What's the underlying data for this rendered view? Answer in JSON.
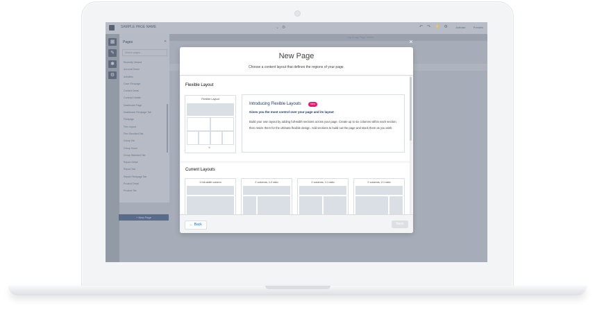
{
  "app": {
    "title": "SAMPLE PAGE NAME",
    "canvas_label": "Lightning Page Name",
    "header_right": [
      "Activate",
      "Preview"
    ],
    "icons": [
      "menu-icon",
      "undo-icon",
      "redo-icon",
      "settings-icon"
    ]
  },
  "sidebar": {
    "title": "Pages",
    "close": "✕",
    "search_placeholder": "Search pages...",
    "items": [
      "Recently Viewed",
      "Account Detail",
      "Activities",
      "Case Flexipage",
      "Contact Detail",
      "Contract Details",
      "Dashboard Page",
      "Dashboard Flexipage Tab",
      "Flexipage",
      "Flex Layout",
      "Flex Standard Tab",
      "Group Tab",
      "Group Home",
      "Group Standard Tab",
      "Report Detail",
      "Report Tab",
      "Report Flexipage Tab",
      "Product Detail",
      "Product Tab"
    ],
    "new_page_button": "+ New Page"
  },
  "modal": {
    "title": "New Page",
    "subtitle": "Choose a content layout that defines the regions of your page.",
    "flexible": {
      "heading": "Flexible Layout",
      "thumb_label": "Flexible Layout",
      "intro_title": "Introducing Flexible Layouts",
      "badge": "New",
      "intro_subtitle": "Gives you the most control over your page and its layout",
      "intro_text": "Build your own layout by adding full-width sections across your page. Create up to six columns within each section, then resize them for the ultimate flexible design. Add sections to build out the page and stack them as you wish."
    },
    "current": {
      "heading": "Current Layouts",
      "layouts": [
        "1 full-width column",
        "2 columns, 1:2 ratio",
        "2 columns, 1:1 ratio",
        "2 columns, 2:1 ratio"
      ]
    },
    "back_label": "Back",
    "next_label": "Next",
    "close_label": "×"
  },
  "colors": {
    "brand_blue": "#0070d2",
    "badge_pink": "#e8186d",
    "navy": "#16325c"
  }
}
